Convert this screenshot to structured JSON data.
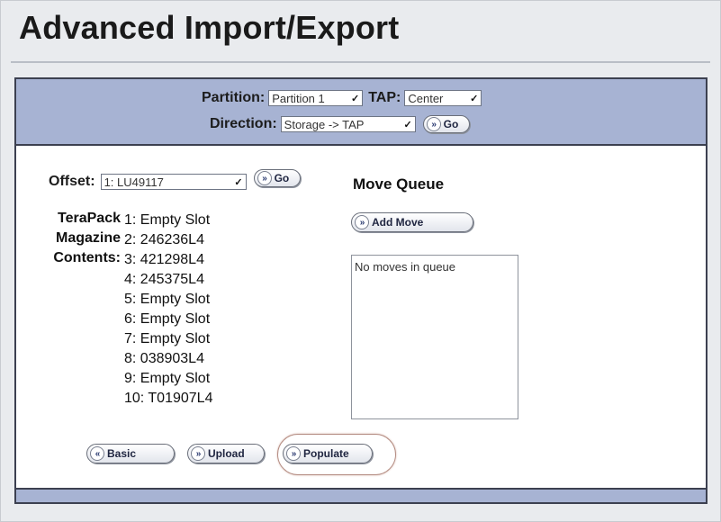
{
  "page": {
    "title": "Advanced Import/Export"
  },
  "header": {
    "partition_label": "Partition:",
    "partition_value": "Partition 1",
    "tap_label": "TAP:",
    "tap_value": "Center",
    "direction_label": "Direction:",
    "direction_value": "Storage -> TAP",
    "go_label": "Go"
  },
  "offset": {
    "label": "Offset:",
    "value": "1: LU49117",
    "go_label": "Go"
  },
  "magazine": {
    "label_lines": [
      "TeraPack",
      "Magazine",
      "Contents:"
    ],
    "slots": [
      "1: Empty Slot",
      "2: 246236L4",
      "3: 421298L4",
      "4: 245375L4",
      "5: Empty Slot",
      "6: Empty Slot",
      "7: Empty Slot",
      "8: 038903L4",
      "9: Empty Slot",
      "10: T01907L4"
    ]
  },
  "move_queue": {
    "title": "Move Queue",
    "add_move_label": "Add Move",
    "empty_text": "No moves in queue"
  },
  "actions": {
    "basic_label": "Basic",
    "upload_label": "Upload",
    "populate_label": "Populate"
  }
}
